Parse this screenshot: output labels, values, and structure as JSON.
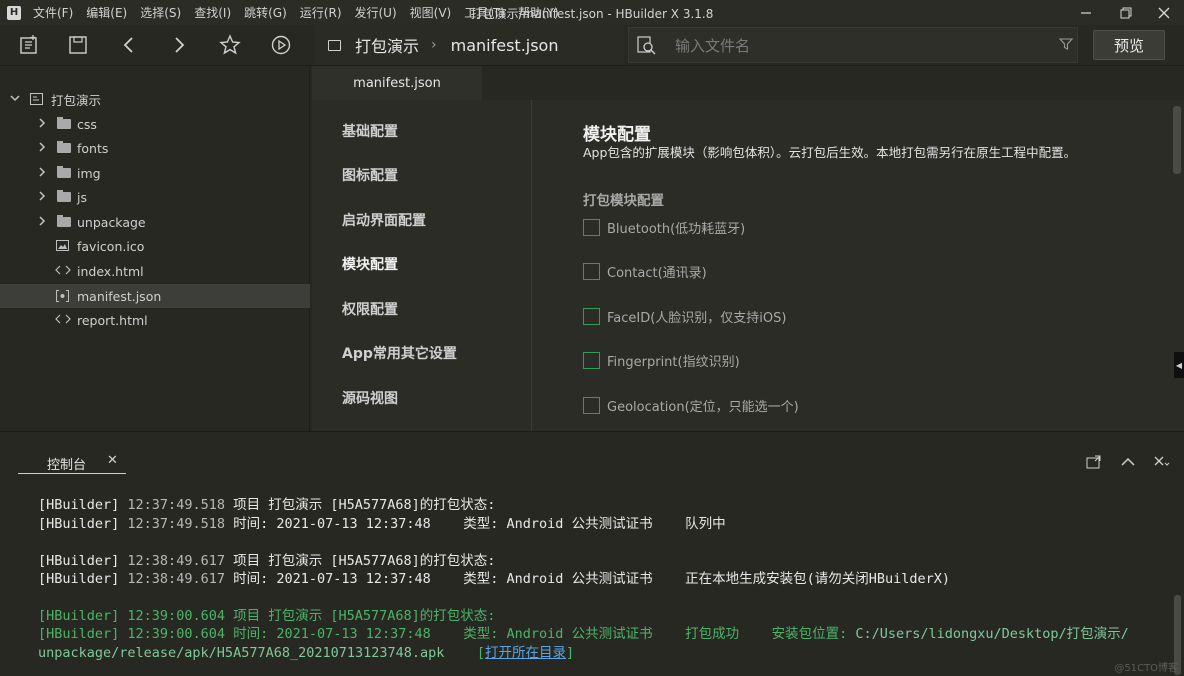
{
  "menu": [
    "文件(F)",
    "编辑(E)",
    "选择(S)",
    "查找(I)",
    "跳转(G)",
    "运行(R)",
    "发行(U)",
    "视图(V)",
    "工具(T)",
    "帮助(Y)"
  ],
  "window_title": "打包演示/manifest.json - HBuilder X 3.1.8",
  "breadcrumb": {
    "project": "打包演示",
    "file": "manifest.json"
  },
  "search": {
    "placeholder": "输入文件名"
  },
  "preview_label": "预览",
  "tree": [
    {
      "label": "打包演示",
      "kind": "project",
      "expanded": true
    },
    {
      "label": "css",
      "kind": "folder"
    },
    {
      "label": "fonts",
      "kind": "folder"
    },
    {
      "label": "img",
      "kind": "folder"
    },
    {
      "label": "js",
      "kind": "folder"
    },
    {
      "label": "unpackage",
      "kind": "folder"
    },
    {
      "label": "favicon.ico",
      "kind": "image"
    },
    {
      "label": "index.html",
      "kind": "html"
    },
    {
      "label": "manifest.json",
      "kind": "json",
      "selected": true
    },
    {
      "label": "report.html",
      "kind": "html"
    }
  ],
  "editor_tab": "manifest.json",
  "settings_nav": [
    "基础配置",
    "图标配置",
    "启动界面配置",
    "模块配置",
    "权限配置",
    "App常用其它设置",
    "源码视图"
  ],
  "active_nav": "模块配置",
  "content": {
    "title": "模块配置",
    "description": "App包含的扩展模块（影响包体积）。云打包后生效。本地打包需另行在原生工程中配置。",
    "section": "打包模块配置",
    "modules": [
      {
        "label": "Bluetooth(低功耗蓝牙)",
        "checked": false
      },
      {
        "label": "Contact(通讯录)",
        "checked": false
      },
      {
        "label": "FaceID(人脸识别，仅支持iOS)",
        "checked": false
      },
      {
        "label": "Fingerprint(指纹识别)",
        "checked": false
      },
      {
        "label": "Geolocation(定位，只能选一个)",
        "checked": false
      }
    ]
  },
  "console": {
    "tab_label": "控制台",
    "lines": [
      {
        "prefix": "[HBuilder]",
        "time": "12:37:49.518",
        "text": " 项目 打包演示 [H5A577A68]的打包状态:"
      },
      {
        "prefix": "[HBuilder]",
        "time": "12:37:49.518",
        "text": " 时间: 2021-07-13 12:37:48    类型: Android 公共测试证书    队列中"
      },
      {
        "prefix": "[HBuilder]",
        "time": "12:38:49.617",
        "text": " 项目 打包演示 [H5A577A68]的打包状态:"
      },
      {
        "prefix": "[HBuilder]",
        "time": "12:38:49.617",
        "text": " 时间: 2021-07-13 12:37:48    类型: Android 公共测试证书    正在本地生成安装包(请勿关闭HBuilderX)"
      },
      {
        "prefix": "[HBuilder]",
        "time": "12:39:00.604",
        "text": " 项目 打包演示 [H5A577A68]的打包状态:"
      },
      {
        "prefix": "[HBuilder]",
        "time": "12:39:00.604",
        "text": " 时间: 2021-07-13 12:37:48    类型: Android 公共测试证书    打包成功    安装包位置: ",
        "path": "C:/Users/lidongxu/Desktop/打包演示/"
      },
      {
        "text": "unpackage/release/apk/H5A577A68_20210713123748.apk",
        "link_pre": "    [",
        "link": "打开所在目录",
        "link_post": "]"
      }
    ]
  },
  "watermark": "@51CTO博客",
  "colors": {
    "accent_green": "#4bb469",
    "link_blue": "#5aa5e6",
    "checkbox_border": "#2f9d5a"
  }
}
